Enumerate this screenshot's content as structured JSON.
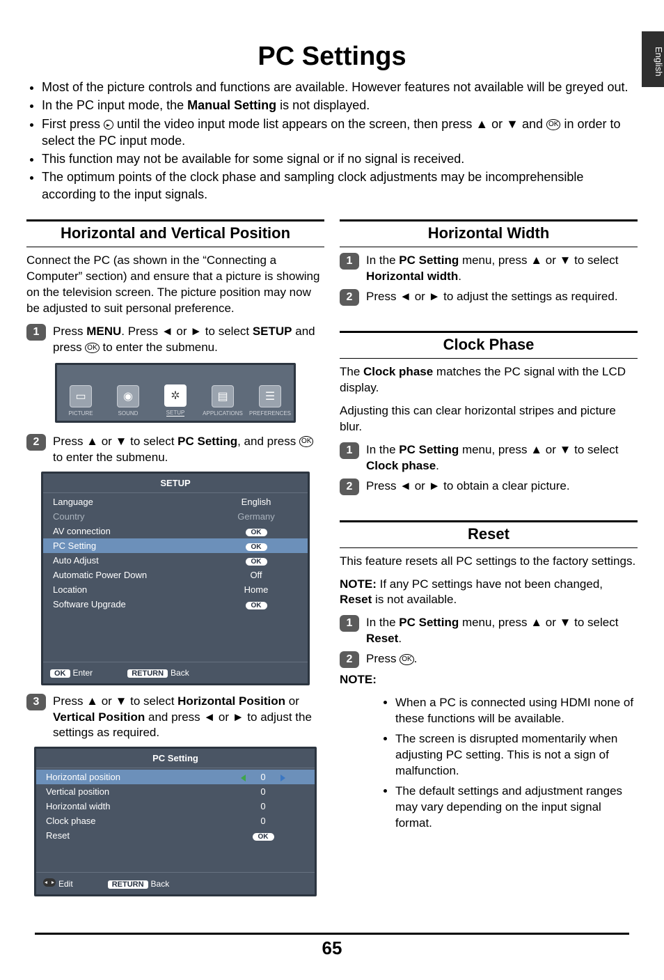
{
  "side_tab": "English",
  "page_title": "PC Settings",
  "intro_bullets": [
    "Most of the picture controls and functions are available. However features not available will be greyed out.",
    "In the PC input mode, the Manual Setting is not displayed.",
    "First press ⊕ until the video input mode list appears on the screen, then press ▲ or ▼ and ⓞ in order to select the PC input mode.",
    "This function may not be available for some signal or if no signal is received.",
    "The optimum points of the clock phase and sampling clock adjustments may be incomprehensible according to the input signals."
  ],
  "left": {
    "horiz_pos": {
      "title": "Horizontal and Vertical Position",
      "intro": "Connect the PC (as shown in the “Connecting a Computer” section) and ensure that a picture is showing on the television screen. The picture position may now be adjusted to suit personal preference.",
      "step1": "Press MENU. Press ◄ or ► to select SETUP and press ⓞ to enter  the submenu.",
      "icon_labels": {
        "picture": "PICTURE",
        "sound": "SOUND",
        "setup": "SETUP",
        "applications": "APPLICATIONS",
        "preferences": "PREFERENCES"
      },
      "step2": "Press ▲ or ▼ to select PC Setting, and press ⓞ to enter the submenu.",
      "setup_panel": {
        "title": "SETUP",
        "rows": [
          {
            "label": "Language",
            "value": "English"
          },
          {
            "label": "Country",
            "value": "Germany",
            "dim": true
          },
          {
            "label": "AV connection",
            "value": "OK"
          },
          {
            "label": "PC Setting",
            "value": "OK",
            "sel": true
          },
          {
            "label": "Auto Adjust",
            "value": "OK"
          },
          {
            "label": "Automatic Power Down",
            "value": "Off"
          },
          {
            "label": "Location",
            "value": "Home"
          },
          {
            "label": "Software Upgrade",
            "value": "OK"
          }
        ],
        "foot": {
          "ok": "OK",
          "enter": "Enter",
          "return": "RETURN",
          "back": "Back"
        }
      },
      "step3": "Press ▲ or ▼ to select Horizontal Position or Vertical Position and press ◄ or ► to adjust the settings as required.",
      "pc_panel": {
        "title": "PC Setting",
        "rows": [
          {
            "label": "Horizontal position",
            "value": "0",
            "sel": true,
            "arrows": true
          },
          {
            "label": "Vertical position",
            "value": "0"
          },
          {
            "label": "Horizontal width",
            "value": "0"
          },
          {
            "label": "Clock phase",
            "value": "0"
          },
          {
            "label": "Reset",
            "value": "OK"
          }
        ],
        "foot": {
          "edit": "Edit",
          "return": "RETURN",
          "back": "Back"
        }
      }
    }
  },
  "right": {
    "horiz_width": {
      "title": "Horizontal Width",
      "step1": "In the PC Setting menu, press ▲ or ▼ to select Horizontal width.",
      "step2": "Press ◄ or ► to adjust the settings as required."
    },
    "clock_phase": {
      "title": "Clock Phase",
      "p1": "The Clock phase matches the PC signal with the LCD display.",
      "p2": "Adjusting this can clear horizontal stripes and picture blur.",
      "step1": "In the PC Setting menu, press ▲ or ▼ to select Clock phase.",
      "step2": "Press ◄ or ► to obtain a clear picture."
    },
    "reset": {
      "title": "Reset",
      "p1": "This feature resets all PC settings to the factory settings.",
      "note": "NOTE: If any PC settings have not been changed, Reset is not available.",
      "step1": "In the PC Setting menu, press ▲ or ▼ to select Reset.",
      "step2": "Press ⓞ.",
      "notes_title": "NOTE:",
      "notes": [
        "When a PC is connected using HDMI none of these functions will be available.",
        "The screen is disrupted momentarily when adjusting PC setting. This is not a sign of malfunction.",
        "The default settings and adjustment ranges may vary depending on the input signal format."
      ]
    }
  },
  "page_number": "65"
}
